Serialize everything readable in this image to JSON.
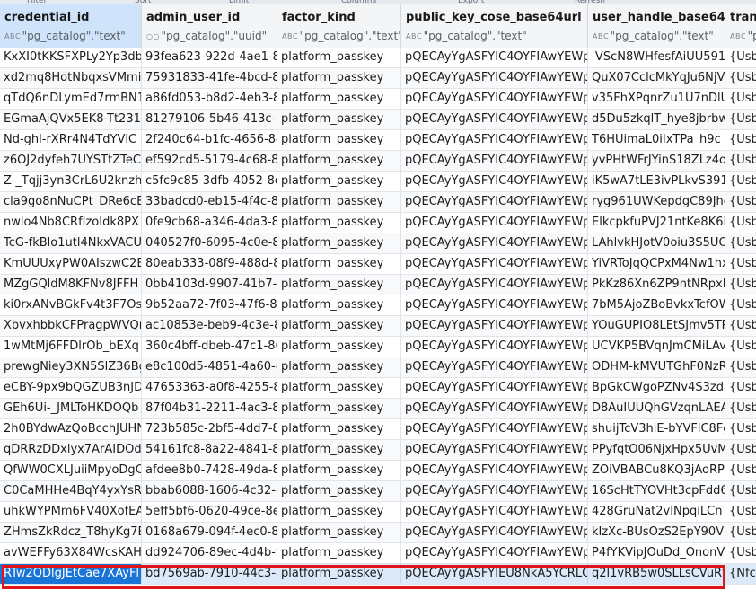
{
  "toolbar_strip": [
    "Filter",
    "Sort",
    "Limit",
    "Columns",
    "Export",
    "Refresh"
  ],
  "columns": [
    {
      "name": "credential_id",
      "type": "\"pg_catalog\".\"text\"",
      "type_icon": "A B C"
    },
    {
      "name": "admin_user_id",
      "type": "\"pg_catalog\".\"uuid\"",
      "type_icon": "○ ○"
    },
    {
      "name": "factor_kind",
      "type": "\"pg_catalog\".\"text\"",
      "type_icon": "A B C"
    },
    {
      "name": "public_key_cose_base64url",
      "type": "\"pg_catalog\".\"text\"",
      "type_icon": "A B C"
    },
    {
      "name": "user_handle_base64url",
      "type": "\"pg_catalog\".\"text\"",
      "type_icon": "A B C"
    },
    {
      "name": "transports",
      "type": "\"pg_catalog\"",
      "type_icon": "A B C"
    }
  ],
  "rows": [
    [
      "KxXI0tKKSFXPLy2Yp3dbl",
      "93fea623-922d-4ae1-8a",
      "platform_passkey",
      "pQECAyYgASFYIC4OYFIAwYEWpO",
      "-VScN8WHfesfAiUU5912",
      "{Usb}"
    ],
    [
      "xd2mq8HotNbqxsVMmi",
      "75931833-41fe-4bcd-89",
      "platform_passkey",
      "pQECAyYgASFYIC4OYFIAwYEWpO",
      "QuX07CclcMkYqJu6NjVH",
      "{Usb}"
    ],
    [
      "qTdQ6nDLymEd7rmBN1",
      "a86fd053-b8d2-4eb3-89",
      "platform_passkey",
      "pQECAyYgASFYIC4OYFIAwYEWpO",
      "v35FhXPqnrZu1U7nDlUN",
      "{Usb}"
    ],
    [
      "EGmaAjQVx5EK8-Tt231-",
      "81279106-5b46-413c-88",
      "platform_passkey",
      "pQECAyYgASFYIC4OYFIAwYEWpO",
      "d5Du5zkqlT_hye8jbrbwC",
      "{Usb}"
    ],
    [
      "Nd-ghl-rXRr4N4TdYVlC",
      "2f240c64-b1fc-4656-846",
      "platform_passkey",
      "pQECAyYgASFYIC4OYFIAwYEWpO",
      "T6HUimaL0iIxTPa_h9c_Jv",
      "{Usb}"
    ],
    [
      "z6OJ2dyfeh7UYSTtZTeC",
      "ef592cd5-5179-4c68-8bf",
      "platform_passkey",
      "pQECAyYgASFYIC4OYFIAwYEWpO",
      "yvPHtWFrJYinS18ZLz4oM",
      "{Usb}"
    ],
    [
      "Z-_Tqjj3yn3CrL6U2knzhn",
      "c5fc9c85-3dfb-4052-8d2",
      "platform_passkey",
      "pQECAyYgASFYIC4OYFIAwYEWpO",
      "iK5wA7tLE3ivPLkvS391Fv",
      "{Usb}"
    ],
    [
      "cla9go8nNuCPt_DRe6cE",
      "33badcd0-eb15-4f4c-85",
      "platform_passkey",
      "pQECAyYgASFYIC4OYFIAwYEWpO",
      "ryg961UWKepdgC89Jhg",
      "{Usb}"
    ],
    [
      "nwlo4Nb8CRfIzoIdk8PX",
      "0fe9cb68-a346-4da3-8a",
      "platform_passkey",
      "pQECAyYgASFYIC4OYFIAwYEWpO",
      "ElkcpkfuPVJ21ntKe8K6L",
      "{Usb}"
    ],
    [
      "TcG-fkBlo1utl4NkxVACU",
      "040527f0-6095-4c0e-84",
      "platform_passkey",
      "pQECAyYgASFYIC4OYFIAwYEWpO",
      "LAhlvkHJotV0oiu3S5UO",
      "{Usb}"
    ],
    [
      "KmUUUxyPW0AIszwC2E",
      "80eab333-08f9-488d-8c",
      "platform_passkey",
      "pQECAyYgASFYIC4OYFIAwYEWpO",
      "YiVRToJqQCPxM4Nw1hx",
      "{Usb}"
    ],
    [
      "MZgGQldM8KFNv8JFFH",
      "0bb4103d-9907-41b7-84",
      "platform_passkey",
      "pQECAyYgASFYIC4OYFIAwYEWpO",
      "PkKz86Xn6ZP9ntNRpxR",
      "{Usb}"
    ],
    [
      "ki0rxANvBGkFv4t3F7Osng",
      "9b52aa72-7f03-47f6-8f",
      "platform_passkey",
      "pQECAyYgASFYIC4OYFIAwYEWpO",
      "7bM5AjoZBoBvkxTcfOW",
      "{Usb}"
    ],
    [
      "XbvxhbbkCFPragpWVQr",
      "ac10853e-beb9-4c3e-8d",
      "platform_passkey",
      "pQECAyYgASFYIC4OYFIAwYEWpO",
      "YOuGUPIO8LEtSJmv5TPI",
      "{Usb}"
    ],
    [
      "1wMtMj6FFDlrOb_bEXq",
      "360c4bff-dbeb-47c1-86",
      "platform_passkey",
      "pQECAyYgASFYIC4OYFIAwYEWpO",
      "UCVKP5BVqnJmCMiLAvE",
      "{Usb}"
    ],
    [
      "prewgNiey3XN5SlZ36Bg",
      "e8c100d5-4851-4a60-80",
      "platform_passkey",
      "pQECAyYgASFYIC4OYFIAwYEWpO",
      "ODHM-kMVUTGhF0NzR",
      "{Usb}"
    ],
    [
      "eCBY-9px9bQGZUB3nJD",
      "47653363-a0f8-4255-85",
      "platform_passkey",
      "pQECAyYgASFYIC4OYFIAwYEWpO",
      "BpGkCWgoPZNv4S3zda",
      "{Usb}"
    ],
    [
      "GEh6Ui-_JMLToHKDOQb",
      "87f04b31-2211-4ac3-82",
      "platform_passkey",
      "pQECAyYgASFYIC4OYFIAwYEWpO",
      "D8AuIUUQhGVzqnLAEAI",
      "{Usb}"
    ],
    [
      "2h0BYdwAzQoBcchJUHN",
      "723b585c-2bf5-4dd7-87",
      "platform_passkey",
      "pQECAyYgASFYIC4OYFIAwYEWpO",
      "shuijTcV3hiE-bYVFlC8Fg",
      "{Usb}"
    ],
    [
      "qDRRzDDxlyx7ArAIDOdj",
      "54161fc8-8a22-4841-8e",
      "platform_passkey",
      "pQECAyYgASFYIC4OYFIAwYEWpO",
      "PPyfqtO06NjxHpx5UvMu",
      "{Usb}"
    ],
    [
      "QfWW0CXLJuiiMpyoDgC",
      "afdee8b0-7428-49da-85",
      "platform_passkey",
      "pQECAyYgASFYIC4OYFIAwYEWpO",
      "ZOiVBABCu8KQ3jAoRP5",
      "{Usb}"
    ],
    [
      "C0CaMHHe4BqY4yxYsRu",
      "bbab6088-1606-4c32-8e",
      "platform_passkey",
      "pQECAyYgASFYIC4OYFIAwYEWpO",
      "16ScHtTYOVHt3cpFdd6V",
      "{Usb}"
    ],
    [
      "uhkWYPMm6FV40XofEA",
      "5eff5bf6-0620-49ce-8eb",
      "platform_passkey",
      "pQECAyYgASFYIC4OYFIAwYEWpO",
      "428GruNat2vINpqiLCnT",
      "{Usb}"
    ],
    [
      "ZHmsZkRdcz_T8hyKg7EI",
      "0168a679-094f-4ec0-81",
      "platform_passkey",
      "pQECAyYgASFYIC4OYFIAwYEWpO",
      "kIzXc-BUsOzS2EpY90VD",
      "{Usb}"
    ],
    [
      "avWEFFy63X84WcsKAHv",
      "dd924706-89ec-4d4b-92",
      "platform_passkey",
      "pQECAyYgASFYIC4OYFIAwYEWpO",
      "P4fYKVipJOuDd_OnonVp",
      "{Usb}"
    ],
    [
      "RTw2QDlgJEtCae7XAyFl",
      "bd7569ab-7910-44c3-8b",
      "platform_passkey",
      "pQECAyYgASFYIEU8NkA5YCRLQm",
      "q2l1vRB5w0SLLsCVuRtV",
      "{Nfc,U"
    ]
  ],
  "selected_row": 25
}
